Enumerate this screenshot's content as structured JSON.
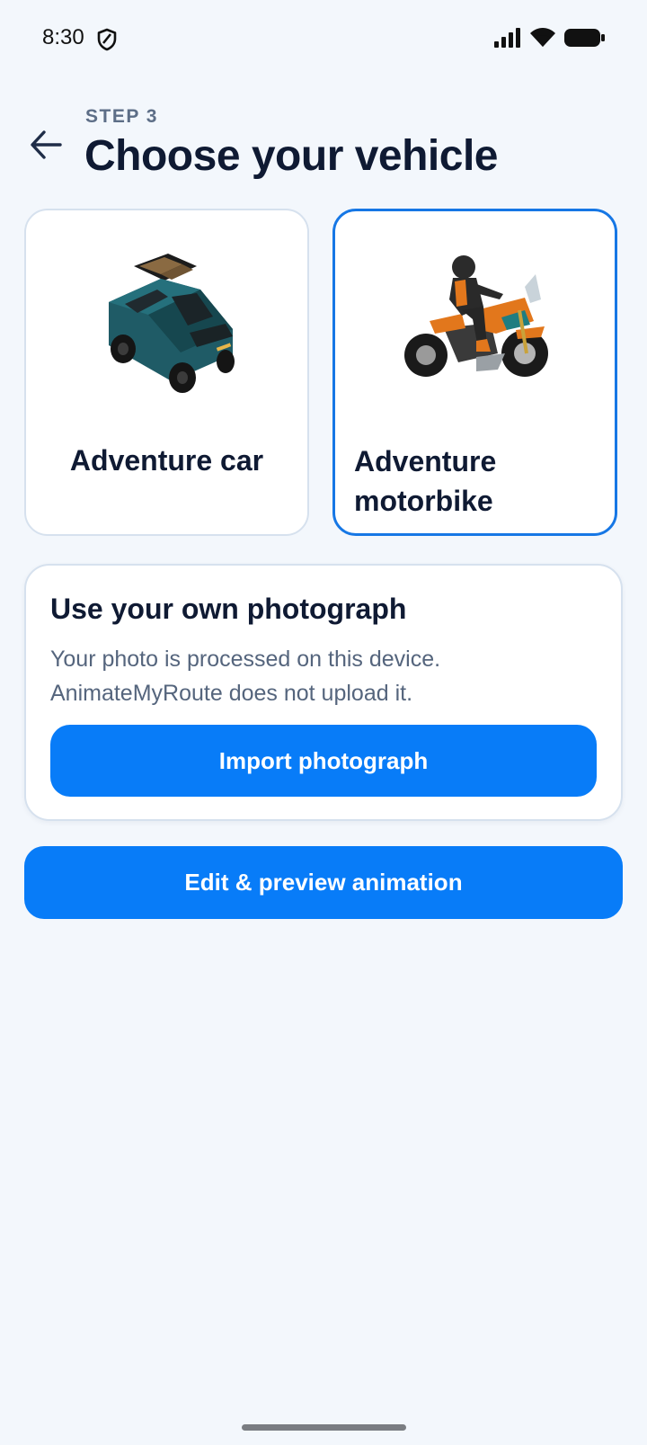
{
  "status_bar": {
    "time": "8:30",
    "icons": [
      "shield-icon",
      "signal-icon",
      "wifi-icon",
      "battery-icon"
    ]
  },
  "header": {
    "step": "STEP 3",
    "title": "Choose your vehicle",
    "back_icon": "arrow-left-icon"
  },
  "vehicles": [
    {
      "id": "car",
      "label": "Adventure car",
      "selected": false,
      "icon": "suv-car-image"
    },
    {
      "id": "motorbike",
      "label": "Adventure motorbike",
      "selected": true,
      "icon": "adventure-motorbike-image"
    }
  ],
  "photo_section": {
    "title": "Use your own photograph",
    "description": "Your photo is processed on this device. AnimateMyRoute does not upload it.",
    "button_label": "Import photograph"
  },
  "primary_action": {
    "label": "Edit & preview animation"
  },
  "colors": {
    "background": "#f3f7fc",
    "accent": "#087cf8",
    "selected_border": "#1677e5",
    "text_primary": "#0f1a33",
    "text_secondary": "#55657d"
  }
}
